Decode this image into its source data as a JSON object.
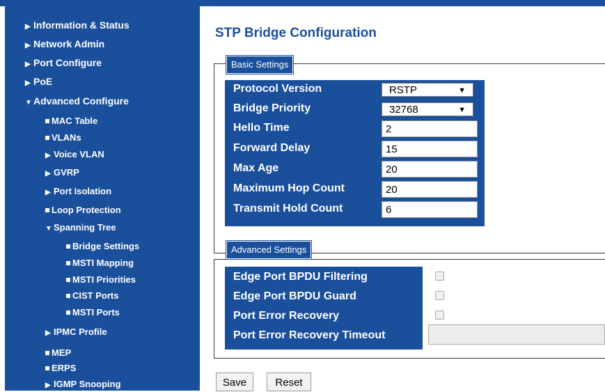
{
  "sidebar": {
    "items": [
      {
        "label": "Information & Status",
        "mark": "▶"
      },
      {
        "label": "Network Admin",
        "mark": "▶"
      },
      {
        "label": "Port Configure",
        "mark": "▶"
      },
      {
        "label": "PoE",
        "mark": "▶"
      },
      {
        "label": "Advanced Configure",
        "mark": "▼"
      },
      {
        "label": "MAC Table",
        "mark": "■"
      },
      {
        "label": "VLANs",
        "mark": "■"
      },
      {
        "label": "Voice VLAN",
        "mark": "▶"
      },
      {
        "label": "GVRP",
        "mark": "▶"
      },
      {
        "label": "Port Isolation",
        "mark": "▶"
      },
      {
        "label": "Loop Protection",
        "mark": "■"
      },
      {
        "label": "Spanning Tree",
        "mark": "▼"
      },
      {
        "label": "Bridge Settings",
        "mark": "■"
      },
      {
        "label": "MSTI Mapping",
        "mark": "■"
      },
      {
        "label": "MSTI Priorities",
        "mark": "■"
      },
      {
        "label": "CIST Ports",
        "mark": "■"
      },
      {
        "label": "MSTI Ports",
        "mark": "■"
      },
      {
        "label": "IPMC Profile",
        "mark": "▶"
      },
      {
        "label": "MEP",
        "mark": "■"
      },
      {
        "label": "ERPS",
        "mark": "■"
      },
      {
        "label": "IGMP Snooping",
        "mark": "▶"
      }
    ]
  },
  "page": {
    "title": "STP Bridge Configuration"
  },
  "basic": {
    "legend": "Basic Settings",
    "protocol_version": {
      "label": "Protocol Version",
      "value": "RSTP"
    },
    "bridge_priority": {
      "label": "Bridge Priority",
      "value": "32768"
    },
    "hello_time": {
      "label": "Hello Time",
      "value": "2"
    },
    "forward_delay": {
      "label": "Forward Delay",
      "value": "15"
    },
    "max_age": {
      "label": "Max Age",
      "value": "20"
    },
    "max_hop_count": {
      "label": "Maximum Hop Count",
      "value": "20"
    },
    "transmit_hold_count": {
      "label": "Transmit Hold Count",
      "value": "6"
    }
  },
  "advanced": {
    "legend": "Advanced Settings",
    "edge_bpdu_filtering": {
      "label": "Edge Port BPDU Filtering",
      "checked": false
    },
    "edge_bpdu_guard": {
      "label": "Edge Port BPDU Guard",
      "checked": false
    },
    "port_error_recovery": {
      "label": "Port Error Recovery",
      "checked": false
    },
    "port_error_recovery_timeout": {
      "label": "Port Error Recovery Timeout",
      "value": ""
    }
  },
  "buttons": {
    "save": "Save",
    "reset": "Reset"
  },
  "colors": {
    "brand": "#1a4f9c"
  }
}
